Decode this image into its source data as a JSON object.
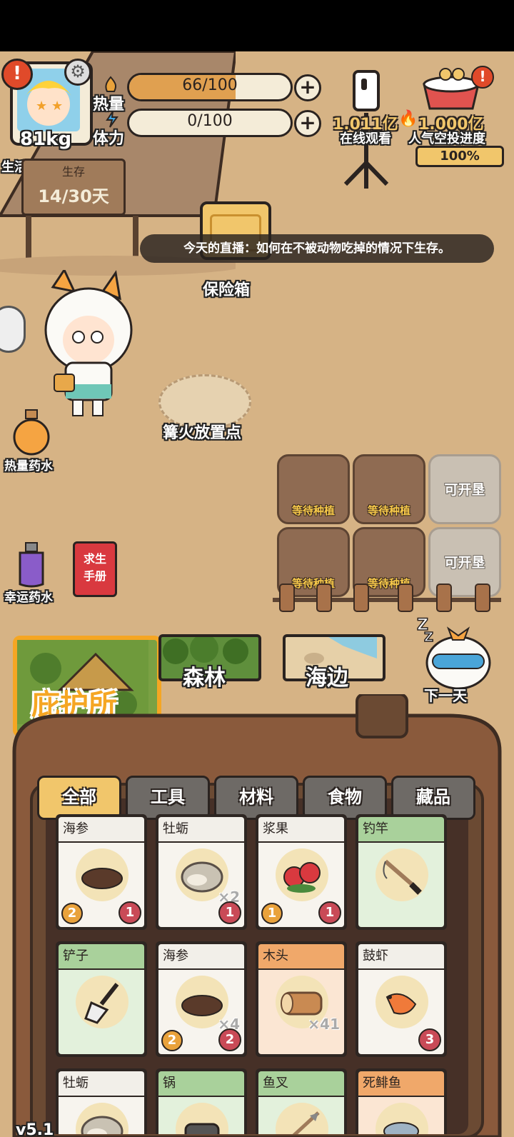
{
  "player": {
    "weight": "81kg",
    "life_attitude": "生活态度。",
    "survive_label": "生存",
    "days": "14/30天"
  },
  "stats": {
    "heat_label": "热量",
    "heat_value": "66/100",
    "heat_fraction": 0.66,
    "stamina_label": "体力",
    "stamina_value": "0/100",
    "stamina_fraction": 0.0
  },
  "live": {
    "viewers": "1.011亿",
    "viewers_label": "在线观看",
    "popularity": "1.000亿",
    "popularity_label": "人气空投进度",
    "progress": "100%"
  },
  "broadcast": "今天的直播：如何在不被动物吃掉的情况下生存。",
  "scene": {
    "safe_label": "保险箱",
    "campfire_label": "篝火放置点",
    "heat_potion": "热量药水",
    "luck_potion": "幸运药水",
    "manual_line1": "求生",
    "manual_line2": "手册",
    "plots": [
      {
        "label": "等待种植",
        "locked": false
      },
      {
        "label": "等待种植",
        "locked": false
      },
      {
        "label": "可开垦",
        "locked": true
      },
      {
        "label": "等待种植",
        "locked": false
      },
      {
        "label": "等待种植",
        "locked": false
      },
      {
        "label": "可开垦",
        "locked": true
      }
    ]
  },
  "locations": {
    "shelter": "庇护所",
    "forest": "森林",
    "beach": "海边",
    "next_day": "下一天"
  },
  "tabs": [
    "全部",
    "工具",
    "材料",
    "食物",
    "藏品"
  ],
  "inventory": [
    {
      "name": "海参",
      "qty": "",
      "lvl": "2",
      "rarity": "1",
      "theme": "white",
      "icon": "sea-cucumber-icon"
    },
    {
      "name": "牡蛎",
      "qty": "×2",
      "lvl": "",
      "rarity": "1",
      "theme": "white",
      "icon": "oyster-icon"
    },
    {
      "name": "浆果",
      "qty": "",
      "lvl": "1",
      "rarity": "1",
      "theme": "white",
      "icon": "berry-icon"
    },
    {
      "name": "钓竿",
      "qty": "",
      "lvl": "",
      "rarity": "",
      "theme": "green",
      "icon": "fishing-rod-icon"
    },
    {
      "name": "铲子",
      "qty": "",
      "lvl": "",
      "rarity": "",
      "theme": "green",
      "icon": "shovel-icon"
    },
    {
      "name": "海参",
      "qty": "×4",
      "lvl": "2",
      "rarity": "2",
      "theme": "white",
      "icon": "sea-cucumber-icon"
    },
    {
      "name": "木头",
      "qty": "×41",
      "lvl": "",
      "rarity": "",
      "theme": "orange",
      "icon": "wood-log-icon"
    },
    {
      "name": "鼓虾",
      "qty": "",
      "lvl": "",
      "rarity": "3",
      "theme": "white",
      "icon": "shrimp-icon"
    },
    {
      "name": "牡蛎",
      "qty": "",
      "lvl": "",
      "rarity": "",
      "theme": "white",
      "icon": "oyster-icon"
    },
    {
      "name": "锅",
      "qty": "",
      "lvl": "",
      "rarity": "",
      "theme": "green",
      "icon": "pot-icon"
    },
    {
      "name": "鱼叉",
      "qty": "",
      "lvl": "",
      "rarity": "",
      "theme": "green",
      "icon": "harpoon-icon"
    },
    {
      "name": "死鲱鱼",
      "qty": "",
      "lvl": "",
      "rarity": "",
      "theme": "orange",
      "icon": "fish-icon"
    }
  ],
  "version": "v5.1",
  "colors": {
    "ground": "#d6b385",
    "backpack": "#8a5a3c",
    "tab_active": "#f1c66b",
    "shelter_border": "#f5a623"
  }
}
